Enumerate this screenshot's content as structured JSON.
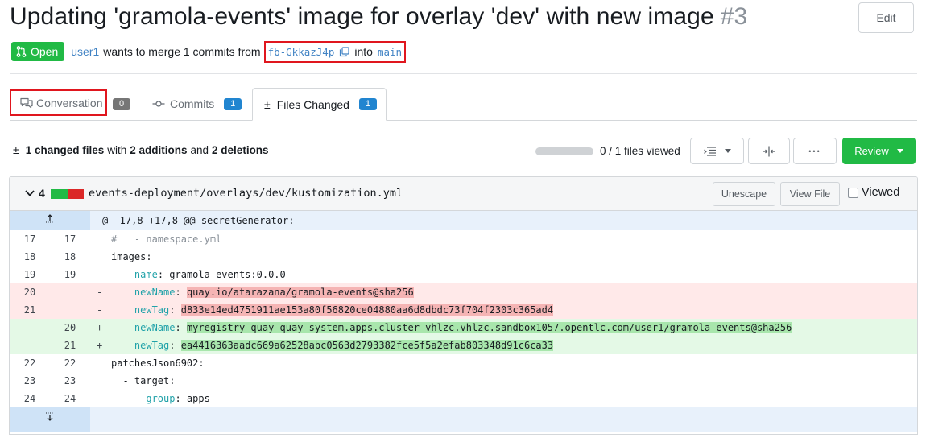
{
  "pr": {
    "title": "Updating 'gramola-events' image for overlay 'dev' with new image",
    "number": "#3",
    "edit_label": "Edit",
    "status": "Open",
    "author": "user1",
    "merge_text": "wants to merge 1 commits from",
    "head_branch": "fb-GkkazJ4p",
    "into_text": "into",
    "base_branch": "main"
  },
  "tabs": [
    {
      "label": "Conversation",
      "count": "0",
      "icon": "conversation-icon"
    },
    {
      "label": "Commits",
      "count": "1",
      "icon": "commit-icon"
    },
    {
      "label": "Files Changed",
      "count": "1",
      "icon": "diff-icon"
    }
  ],
  "diff_summary": {
    "changed_files": "1 changed files",
    "with": "with",
    "additions": "2 additions",
    "and": "and",
    "deletions": "2 deletions",
    "files_viewed": "0 / 1 files viewed",
    "viewed_progress": 0,
    "more_label": "•••",
    "review_label": "Review"
  },
  "colors": {
    "open_green": "#21ba45",
    "badge_blue": "#2185d0",
    "badge_gray": "#767676",
    "highlight_red": "#e0161e"
  },
  "file": {
    "count": "4",
    "path": "events-deployment/overlays/dev/kustomization.yml",
    "unescape_label": "Unescape",
    "view_file_label": "View File",
    "viewed_label": "Viewed",
    "hunk_header": "@ -17,8 +17,8 @@ secretGenerator:",
    "lines": [
      {
        "type": "ctx",
        "old": "17",
        "new": "17",
        "sign": "",
        "indent": "",
        "key": "",
        "sep": "",
        "val": "#   - namespace.yml",
        "comment": true
      },
      {
        "type": "ctx",
        "old": "18",
        "new": "18",
        "sign": "",
        "indent": "",
        "key": "",
        "sep": "",
        "val": "images:"
      },
      {
        "type": "ctx",
        "old": "19",
        "new": "19",
        "sign": "",
        "indent": "  - ",
        "key": "name",
        "sep": ": ",
        "val": "gramola-events:0.0.0"
      },
      {
        "type": "del",
        "old": "20",
        "new": "",
        "sign": "-",
        "indent": "    ",
        "key": "newName",
        "sep": ": ",
        "val": "quay.io/atarazana/gramola-events@sha256"
      },
      {
        "type": "del",
        "old": "21",
        "new": "",
        "sign": "-",
        "indent": "    ",
        "key": "newTag",
        "sep": ": ",
        "val": "d833e14ed4751911ae153a80f56820ce04880aa6d8dbdc73f704f2303c365ad4"
      },
      {
        "type": "add",
        "old": "",
        "new": "20",
        "sign": "+",
        "indent": "    ",
        "key": "newName",
        "sep": ": ",
        "val": "myregistry-quay-quay-system.apps.cluster-vhlzc.vhlzc.sandbox1057.opentlc.com/user1/gramola-events@sha256"
      },
      {
        "type": "add",
        "old": "",
        "new": "21",
        "sign": "+",
        "indent": "    ",
        "key": "newTag",
        "sep": ": ",
        "val": "ea4416363aadc669a62528abc0563d2793382fce5f5a2efab803348d91c6ca33"
      },
      {
        "type": "ctx",
        "old": "22",
        "new": "22",
        "sign": "",
        "indent": "",
        "key": "",
        "sep": "",
        "val": "patchesJson6902:"
      },
      {
        "type": "ctx",
        "old": "23",
        "new": "23",
        "sign": "",
        "indent": "  - ",
        "key": "",
        "sep": "",
        "val": "target:"
      },
      {
        "type": "ctx",
        "old": "24",
        "new": "24",
        "sign": "",
        "indent": "      ",
        "key": "group",
        "sep": ": ",
        "val": "apps"
      }
    ]
  }
}
